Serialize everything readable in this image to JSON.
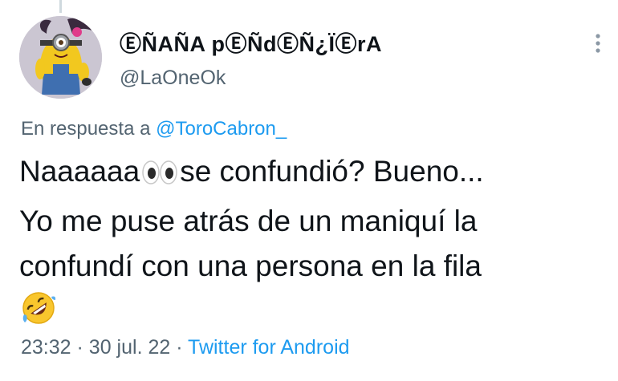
{
  "tweet": {
    "author": {
      "display_name": "ⒺÑAÑA pⒺÑdⒺÑ¿ÏⒺrA",
      "handle": "@LaOneOk",
      "avatar_icon": "minion-avatar"
    },
    "reply": {
      "prefix": "En respuesta a",
      "mention": "@ToroCabron_"
    },
    "text": {
      "line1_start": "Naaaaaa",
      "line1_emoji": "eyes-emoji",
      "line1_end": "se confundió? Bueno...",
      "line2": "Yo me puse atrás de un maniquí la",
      "line3": "confundí con una persona en la fila",
      "final_emoji": "rolling-on-floor-laughing-emoji"
    },
    "meta": {
      "time": "23:32",
      "separator1": "·",
      "date": "30 jul. 22",
      "separator2": "·",
      "source": "Twitter for Android"
    }
  },
  "colors": {
    "text_primary": "#0f1419",
    "text_secondary": "#536471",
    "link": "#1d9bf0",
    "thread_line": "#cfd9de"
  }
}
